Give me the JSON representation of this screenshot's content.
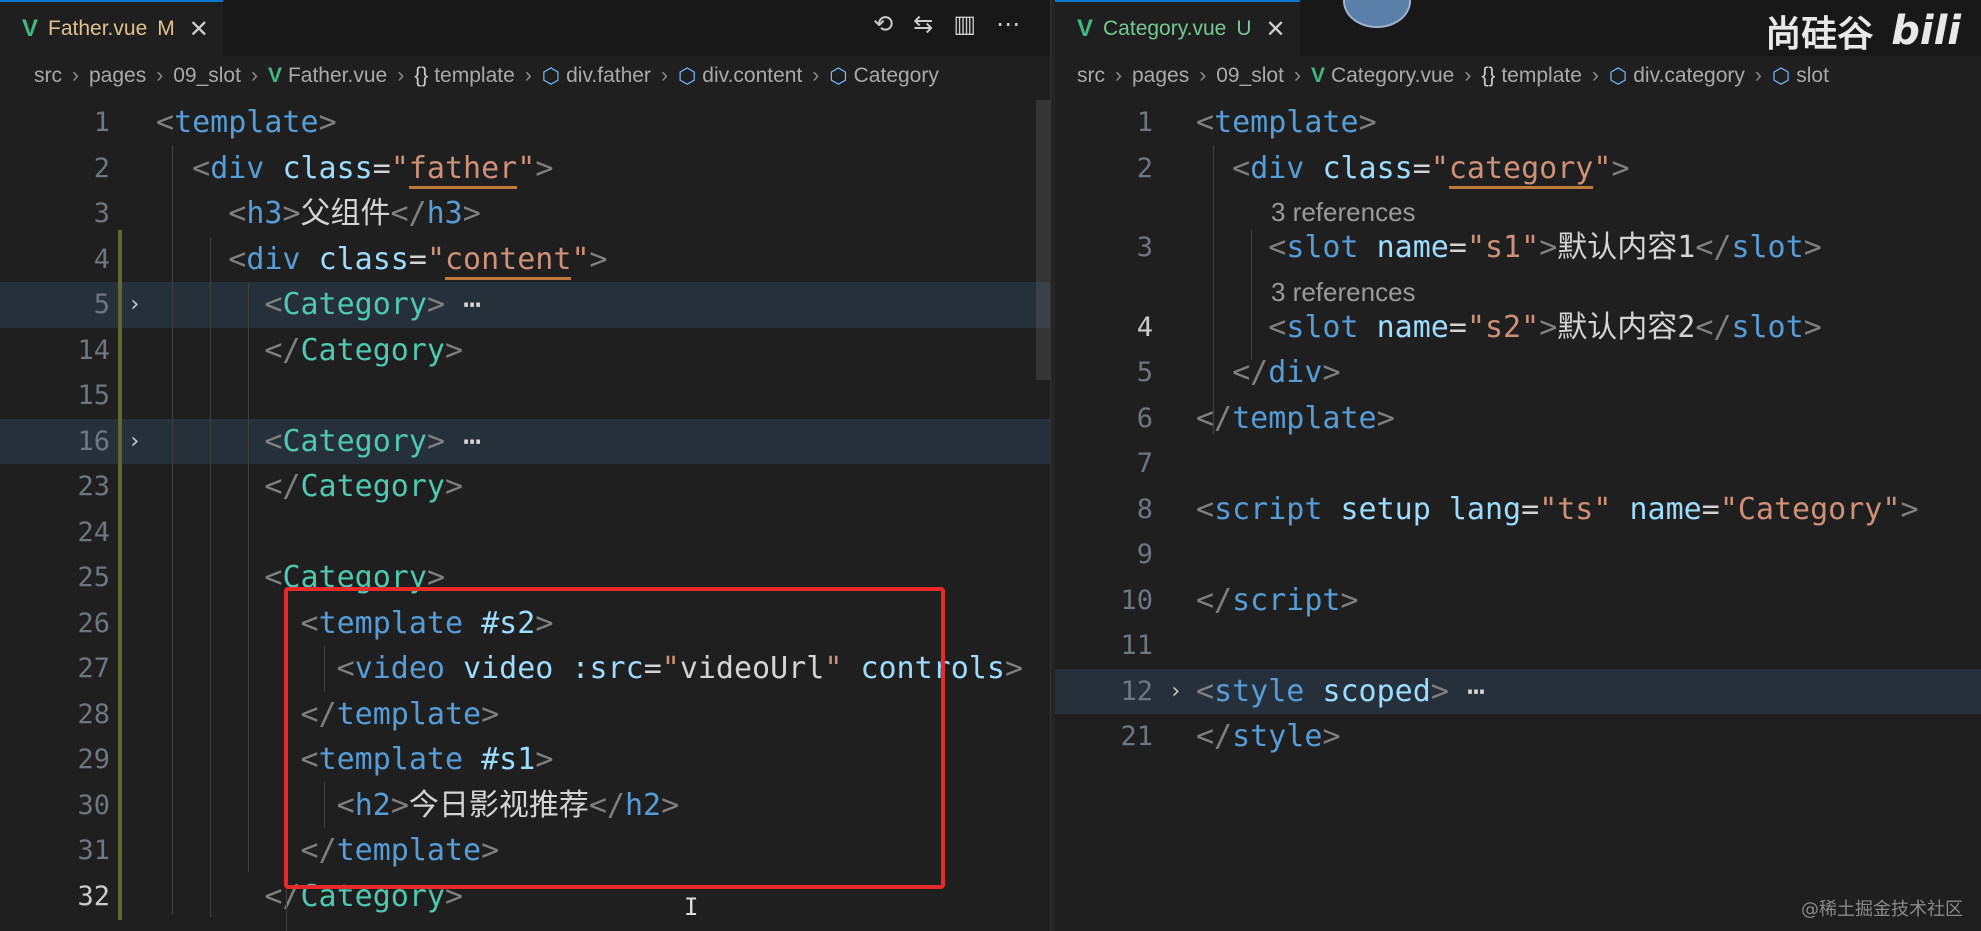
{
  "left": {
    "tab": {
      "icon": "vue-icon",
      "name": "Father.vue",
      "status": "M",
      "close": "✕"
    },
    "actions": [
      "⟲",
      "⇆",
      "▥",
      "⋯"
    ],
    "breadcrumb": [
      "src",
      "pages",
      "09_slot",
      "Father.vue",
      "template",
      "div.father",
      "div.content",
      "Category"
    ],
    "lines": [
      {
        "n": "1",
        "html": "<span class='p'>&lt;</span><span class='t'>template</span><span class='p'>&gt;</span>"
      },
      {
        "n": "2",
        "html": "  <span class='p'>&lt;</span><span class='t'>div</span> <span class='a'>class</span><span class='x'>=</span><span class='s'>\"</span><span class='u'>father</span><span class='s'>\"</span><span class='p'>&gt;</span>"
      },
      {
        "n": "3",
        "html": "    <span class='p'>&lt;</span><span class='t'>h3</span><span class='p'>&gt;</span><span class='x'>父组件</span><span class='p'>&lt;/</span><span class='t'>h3</span><span class='p'>&gt;</span>"
      },
      {
        "n": "4",
        "html": "    <span class='p'>&lt;</span><span class='t'>div</span> <span class='a'>class</span><span class='x'>=</span><span class='s'>\"</span><span class='u'>content</span><span class='s'>\"</span><span class='p'>&gt;</span>"
      },
      {
        "n": "5",
        "fold": true,
        "highlight": true,
        "html": "      <span class='p'>&lt;</span><span class='c'>Category</span><span class='p'>&gt;</span><span class='x'> ⋯</span>"
      },
      {
        "n": "14",
        "html": "      <span class='p'>&lt;/</span><span class='c'>Category</span><span class='p'>&gt;</span>"
      },
      {
        "n": "15",
        "html": ""
      },
      {
        "n": "16",
        "fold": true,
        "highlight": true,
        "html": "      <span class='p'>&lt;</span><span class='c'>Category</span><span class='p'>&gt;</span><span class='x'> ⋯</span>"
      },
      {
        "n": "23",
        "html": "      <span class='p'>&lt;/</span><span class='c'>Category</span><span class='p'>&gt;</span>"
      },
      {
        "n": "24",
        "html": ""
      },
      {
        "n": "25",
        "html": "      <span class='p'>&lt;</span><span class='c'>Category</span><span class='p'>&gt;</span>"
      },
      {
        "n": "26",
        "html": "        <span class='p'>&lt;</span><span class='t'>template</span> <span class='a'>#s2</span><span class='p'>&gt;</span>"
      },
      {
        "n": "27",
        "html": "          <span class='p'>&lt;</span><span class='t'>video</span> <span class='a'>video</span> <span class='a'>:src</span><span class='x'>=</span><span class='s'>\"</span><span class='x'>videoUrl</span><span class='s'>\"</span> <span class='a'>controls</span><span class='p'>&gt;</span>"
      },
      {
        "n": "28",
        "html": "        <span class='p'>&lt;/</span><span class='t'>template</span><span class='p'>&gt;</span>"
      },
      {
        "n": "29",
        "html": "        <span class='p'>&lt;</span><span class='t'>template</span> <span class='a'>#s1</span><span class='p'>&gt;</span>"
      },
      {
        "n": "30",
        "html": "          <span class='p'>&lt;</span><span class='t'>h2</span><span class='p'>&gt;</span><span class='x'>今日影视推荐</span><span class='p'>&lt;/</span><span class='t'>h2</span><span class='p'>&gt;</span>"
      },
      {
        "n": "31",
        "html": "        <span class='p'>&lt;/</span><span class='t'>template</span><span class='p'>&gt;</span>"
      },
      {
        "n": "32",
        "active": true,
        "html": "      <span class='p'>&lt;/</span><span class='c'>Category</span><span class='p'>&gt;</span>"
      }
    ]
  },
  "right": {
    "tab": {
      "icon": "vue-icon",
      "name": "Category.vue",
      "status": "U",
      "close": "✕"
    },
    "breadcrumb": [
      "src",
      "pages",
      "09_slot",
      "Category.vue",
      "template",
      "div.category",
      "slot"
    ],
    "lines": [
      {
        "n": "1",
        "html": "<span class='p'>&lt;</span><span class='t'>template</span><span class='p'>&gt;</span>"
      },
      {
        "n": "2",
        "html": "  <span class='p'>&lt;</span><span class='t'>div</span> <span class='a'>class</span><span class='x'>=</span><span class='s'>\"</span><span class='u'>category</span><span class='s'>\"</span><span class='p'>&gt;</span>"
      },
      {
        "refs": "3 references"
      },
      {
        "n": "3",
        "html": "    <span class='p'>&lt;</span><span class='t'>slot</span> <span class='a'>name</span><span class='x'>=</span><span class='s'>\"s1\"</span><span class='p'>&gt;</span><span class='x'>默认内容1</span><span class='p'>&lt;/</span><span class='t'>slot</span><span class='p'>&gt;</span>"
      },
      {
        "refs": "3 references"
      },
      {
        "n": "4",
        "active": true,
        "html": "    <span class='p'>&lt;</span><span class='t'>slot</span> <span class='a'>name</span><span class='x'>=</span><span class='s'>\"s2\"</span><span class='p'>&gt;</span><span class='x'>默认内容2</span><span class='p'>&lt;/</span><span class='t'>slot</span><span class='p'>&gt;</span>"
      },
      {
        "n": "5",
        "html": "  <span class='p'>&lt;/</span><span class='t'>div</span><span class='p'>&gt;</span>"
      },
      {
        "n": "6",
        "html": "<span class='p'>&lt;/</span><span class='t'>template</span><span class='p'>&gt;</span>"
      },
      {
        "n": "7",
        "html": ""
      },
      {
        "n": "8",
        "html": "<span class='p'>&lt;</span><span class='t'>script</span> <span class='a'>setup</span> <span class='a'>lang</span><span class='x'>=</span><span class='s'>\"ts\"</span> <span class='a'>name</span><span class='x'>=</span><span class='s'>\"Category\"</span><span class='p'>&gt;</span>"
      },
      {
        "n": "9",
        "html": ""
      },
      {
        "n": "10",
        "html": "<span class='p'>&lt;/</span><span class='t'>script</span><span class='p'>&gt;</span>"
      },
      {
        "n": "11",
        "html": ""
      },
      {
        "n": "12",
        "fold": true,
        "highlight": true,
        "html": "<span class='p'>&lt;</span><span class='t'>style</span> <span class='a'>scoped</span><span class='p'>&gt;</span><span class='x'> ⋯</span>"
      },
      {
        "n": "21",
        "html": "<span class='p'>&lt;/</span><span class='t'>style</span><span class='p'>&gt;</span>"
      }
    ]
  },
  "watermark": {
    "brand": "尚硅谷",
    "logo": "bili"
  },
  "corner_mark": "@稀土掘金技术社区"
}
